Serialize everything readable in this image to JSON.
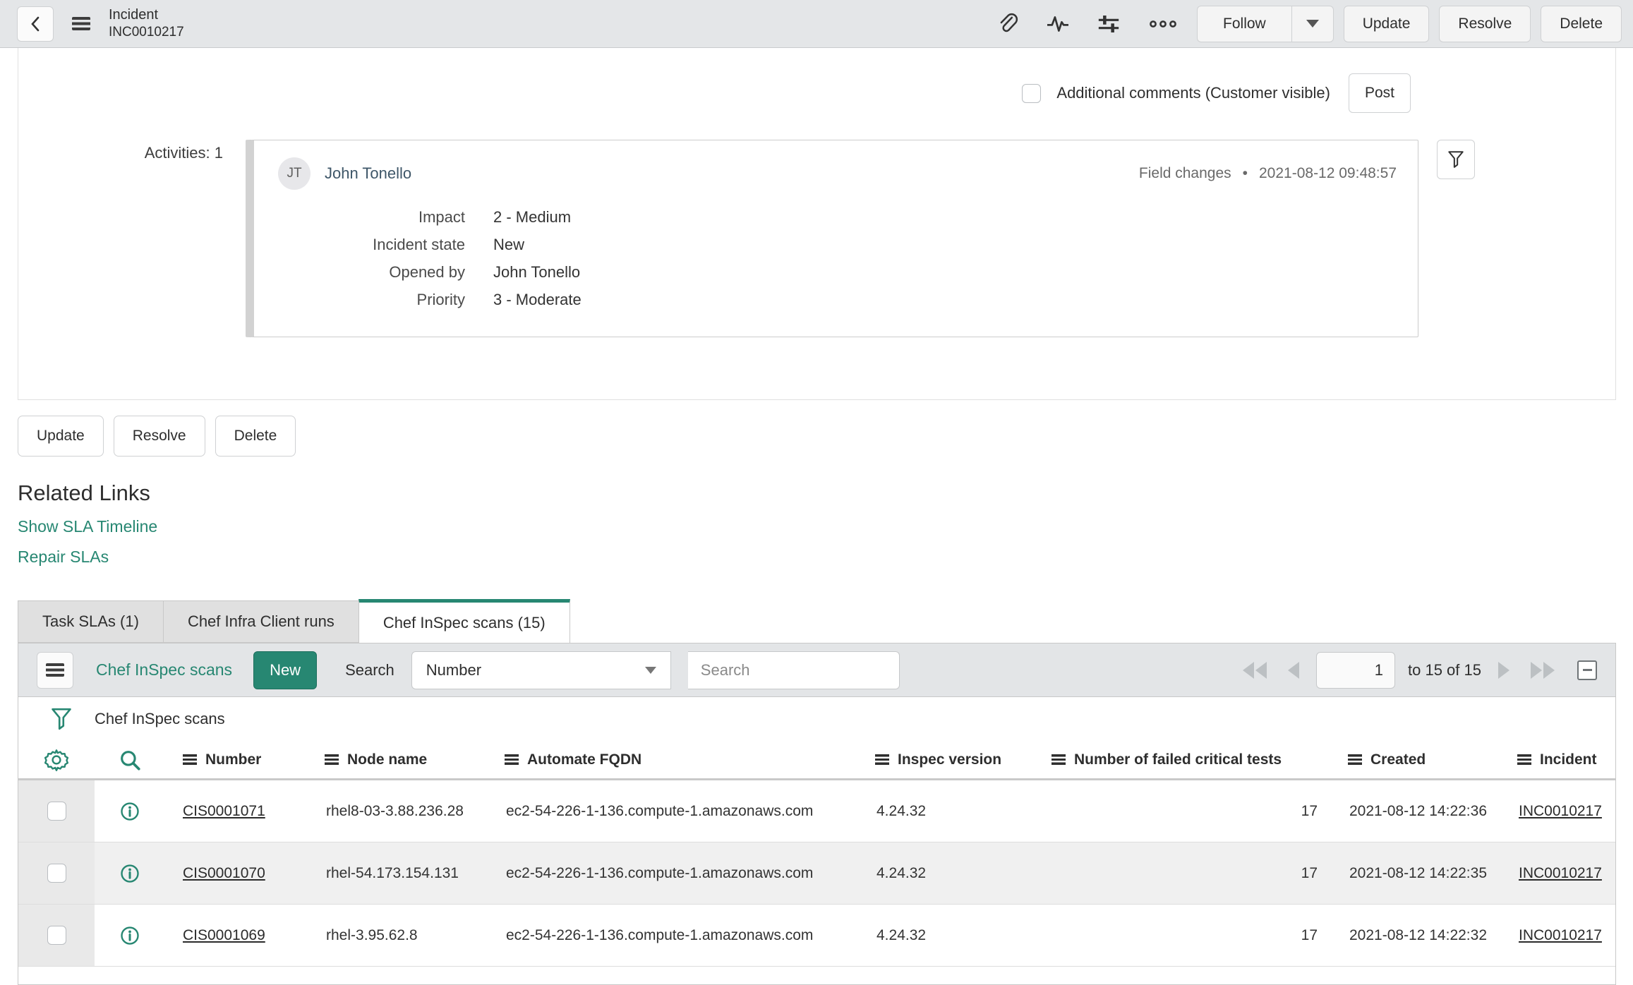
{
  "colors": {
    "accent": "#278772"
  },
  "header": {
    "record_type": "Incident",
    "record_number": "INC0010217",
    "follow_label": "Follow",
    "update_label": "Update",
    "resolve_label": "Resolve",
    "delete_label": "Delete"
  },
  "comments": {
    "label": "Additional comments (Customer visible)",
    "post_label": "Post"
  },
  "activity": {
    "count_label": "Activities: 1",
    "avatar_initials": "JT",
    "user_name": "John Tonello",
    "event_type": "Field changes",
    "separator": "•",
    "timestamp": "2021-08-12 09:48:57",
    "fields": [
      {
        "label": "Impact",
        "value": "2 - Medium"
      },
      {
        "label": "Incident state",
        "value": "New"
      },
      {
        "label": "Opened by",
        "value": "John Tonello"
      },
      {
        "label": "Priority",
        "value": "3 - Moderate"
      }
    ]
  },
  "form_actions": {
    "update": "Update",
    "resolve": "Resolve",
    "delete": "Delete"
  },
  "related_links": {
    "title": "Related Links",
    "links": [
      {
        "label": "Show SLA Timeline"
      },
      {
        "label": "Repair SLAs"
      }
    ]
  },
  "tabs": [
    {
      "label": "Task SLAs (1)"
    },
    {
      "label": "Chef Infra Client runs"
    },
    {
      "label": "Chef InSpec scans (15)"
    }
  ],
  "list": {
    "title": "Chef InSpec scans",
    "new_label": "New",
    "search_label": "Search",
    "search_field": "Number",
    "search_placeholder": "Search",
    "pagination": {
      "page": "1",
      "range": "to 15 of 15"
    },
    "breadcrumb_title": "Chef InSpec scans",
    "columns": [
      {
        "label": "Number"
      },
      {
        "label": "Node name"
      },
      {
        "label": "Automate FQDN"
      },
      {
        "label": "Inspec version"
      },
      {
        "label": "Number of failed critical tests"
      },
      {
        "label": "Created"
      },
      {
        "label": "Incident"
      }
    ],
    "rows": [
      {
        "number": "CIS0001071",
        "node_name": "rhel8-03-3.88.236.28",
        "automate_fqdn": "ec2-54-226-1-136.compute-1.amazonaws.com",
        "inspec_version": "4.24.32",
        "failed_critical_tests": "17",
        "created": "2021-08-12 14:22:36",
        "incident": "INC0010217"
      },
      {
        "number": "CIS0001070",
        "node_name": "rhel-54.173.154.131",
        "automate_fqdn": "ec2-54-226-1-136.compute-1.amazonaws.com",
        "inspec_version": "4.24.32",
        "failed_critical_tests": "17",
        "created": "2021-08-12 14:22:35",
        "incident": "INC0010217"
      },
      {
        "number": "CIS0001069",
        "node_name": "rhel-3.95.62.8",
        "automate_fqdn": "ec2-54-226-1-136.compute-1.amazonaws.com",
        "inspec_version": "4.24.32",
        "failed_critical_tests": "17",
        "created": "2021-08-12 14:22:32",
        "incident": "INC0010217"
      }
    ]
  }
}
